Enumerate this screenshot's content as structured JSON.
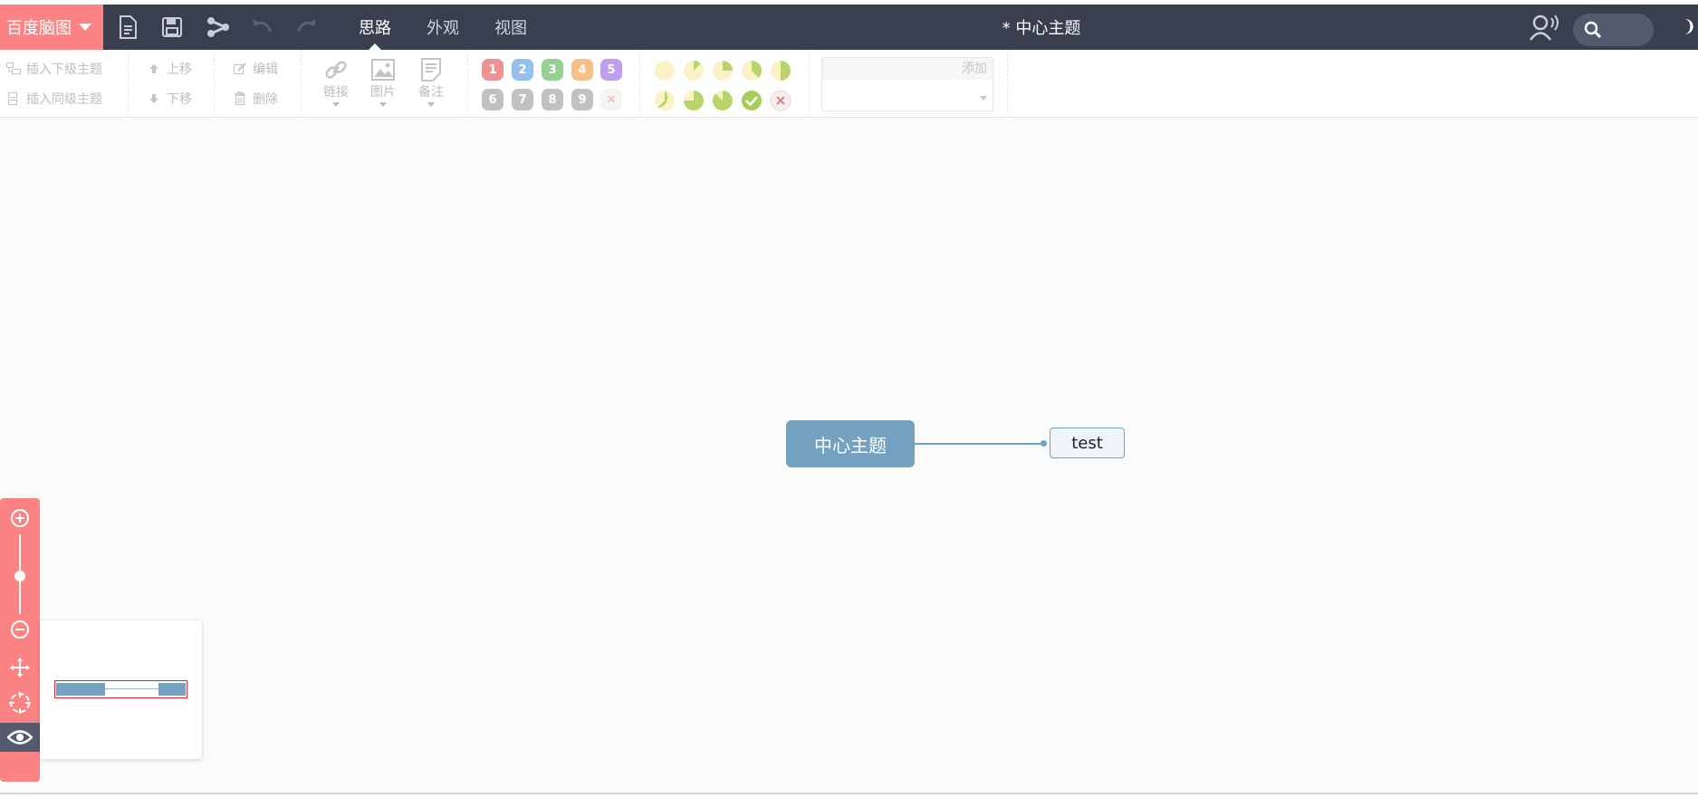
{
  "brand": {
    "label": "百度脑图"
  },
  "quick_actions": [
    "new-file-icon",
    "save-icon",
    "share-icon",
    "undo-icon",
    "redo-icon"
  ],
  "tabs": [
    {
      "label": "思路",
      "active": true
    },
    {
      "label": "外观",
      "active": false
    },
    {
      "label": "视图",
      "active": false
    }
  ],
  "document": {
    "title": "* 中心主题"
  },
  "toolbar": {
    "insert_child": "插入下级主题",
    "insert_sibling": "插入同级主题",
    "move_up": "上移",
    "move_down": "下移",
    "edit": "编辑",
    "delete": "删除",
    "link": "链接",
    "image": "图片",
    "note": "备注",
    "priorities": [
      "1",
      "2",
      "3",
      "4",
      "5",
      "6",
      "7",
      "8",
      "9"
    ],
    "priority_colors": [
      "#e03c3c",
      "#3b8ee0",
      "#3fae3a",
      "#f08c22",
      "#8a4fe0"
    ],
    "tag_add": "添加"
  },
  "mindmap": {
    "root": "中心主题",
    "children": [
      "test"
    ],
    "colors": {
      "root_fill": "#73a1bf",
      "child_fill": "#eef4f7"
    }
  },
  "zoom": {
    "level_fraction": 0.55
  },
  "colors": {
    "topbar": "#393f4f",
    "accent": "#fc8383"
  }
}
